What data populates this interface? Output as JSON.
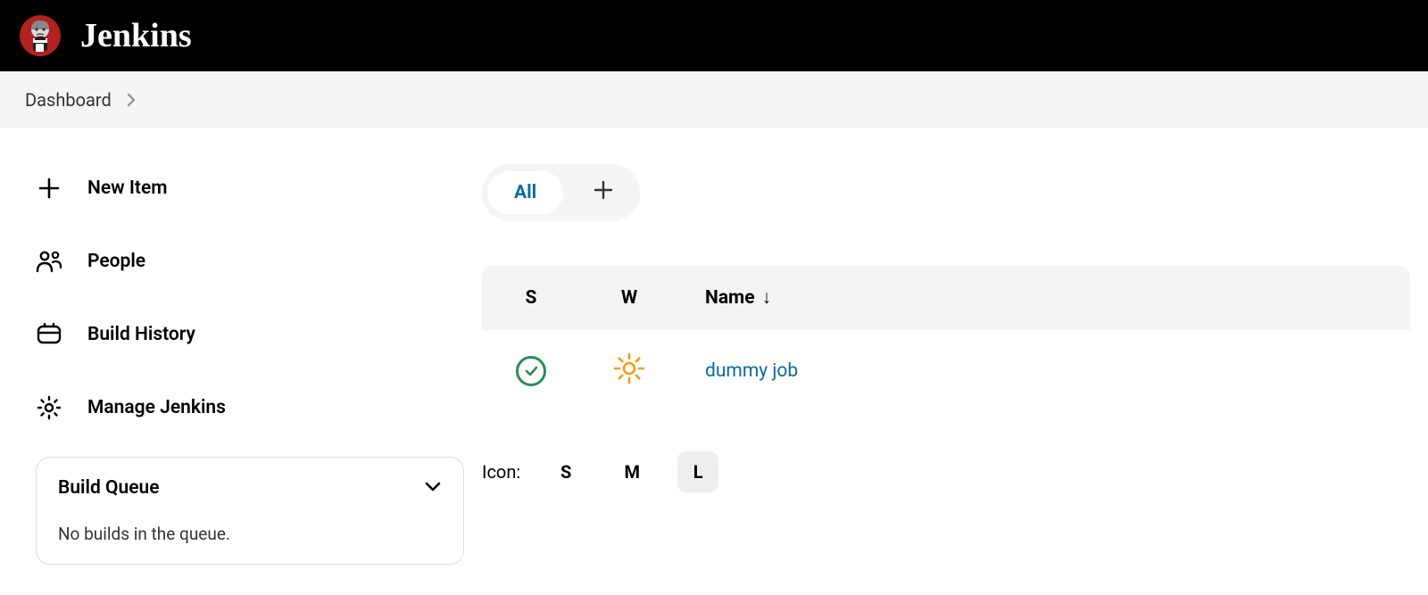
{
  "header": {
    "title": "Jenkins"
  },
  "breadcrumb": {
    "items": [
      "Dashboard"
    ]
  },
  "sidebar": {
    "items": [
      {
        "label": "New Item"
      },
      {
        "label": "People"
      },
      {
        "label": "Build History"
      },
      {
        "label": "Manage Jenkins"
      }
    ]
  },
  "build_queue": {
    "title": "Build Queue",
    "message": "No builds in the queue."
  },
  "views": {
    "active_tab": "All"
  },
  "table": {
    "columns": {
      "s": "S",
      "w": "W",
      "name": "Name",
      "sort_indicator": "↓"
    },
    "rows": [
      {
        "name": "dummy job",
        "status": "success",
        "weather": "sunny"
      }
    ]
  },
  "icon_sizer": {
    "label": "Icon:",
    "small": "S",
    "medium": "M",
    "large": "L",
    "active": "L"
  },
  "colors": {
    "link": "#0b6aa2",
    "success": "#2e8b57",
    "sun": "#f39c12"
  }
}
